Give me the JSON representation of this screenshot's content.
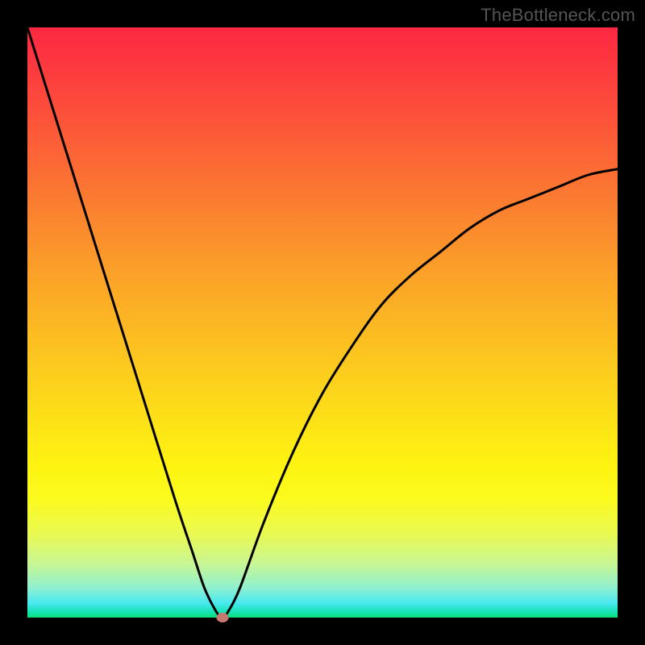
{
  "watermark": "TheBottleneck.com",
  "chart_data": {
    "type": "line",
    "title": "",
    "xlabel": "",
    "ylabel": "",
    "xlim": [
      0,
      100
    ],
    "ylim": [
      0,
      100
    ],
    "background_gradient": {
      "top": "#fd2842",
      "bottom": "#0bdf78",
      "description": "vertical rainbow gradient red→orange→yellow→green"
    },
    "series": [
      {
        "name": "bottleneck-curve",
        "description": "V-shaped curve with minimum near x≈33; left branch rises to top-left corner, right branch rises asymptotically toward upper-right",
        "x": [
          0,
          5,
          10,
          15,
          20,
          25,
          28,
          30,
          32,
          33,
          34,
          36,
          40,
          45,
          50,
          55,
          60,
          65,
          70,
          75,
          80,
          85,
          90,
          95,
          100
        ],
        "y": [
          100,
          84,
          68,
          52,
          36,
          20,
          11,
          5,
          1,
          0,
          1,
          5,
          16,
          28,
          38,
          46,
          53,
          58,
          62,
          66,
          69,
          71,
          73,
          75,
          76
        ]
      }
    ],
    "marker": {
      "name": "optimal-point",
      "x": 33,
      "y": 0,
      "color": "#c97a70"
    }
  }
}
